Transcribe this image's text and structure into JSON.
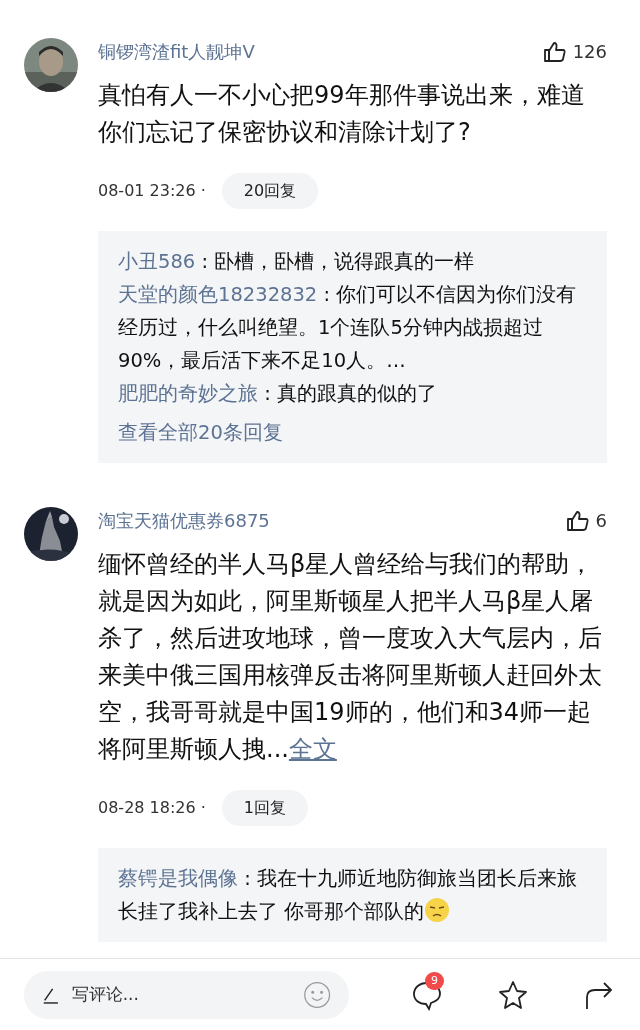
{
  "comments": [
    {
      "user": "铜锣湾渣fit人靓坤V",
      "likes": "126",
      "text": "真怕有人一不小心把99年那件事说出来，难道你们忘记了保密协议和清除计划了?",
      "time": "08-01 23:26 ·",
      "reply_count": "20回复",
      "replies": [
        {
          "user": "小丑586",
          "text": ": 卧槽，卧槽，说得跟真的一样"
        },
        {
          "user": "天堂的颜色18232832",
          "text": ": 你们可以不信因为你们没有经历过，什么叫绝望。1个连队5分钟内战损超过90%，最后活下来不足10人。…"
        },
        {
          "user": "肥肥的奇妙之旅",
          "text": ": 真的跟真的似的了"
        }
      ],
      "view_all": "查看全部20条回复"
    },
    {
      "user": "淘宝天猫优惠券6875",
      "likes": "6",
      "text": "缅怀曾经的半人马β星人曾经给与我们的帮助，就是因为如此，阿里斯顿星人把半人马β星人屠杀了，然后进攻地球，曾一度攻入大气层内，后来美中俄三国用核弹反击将阿里斯顿人赶回外太空，我哥哥就是中国19师的，他们和34师一起将阿里斯顿人拽...",
      "more": "全文",
      "time": "08-28 18:26 ·",
      "reply_count": "1回复",
      "replies": [
        {
          "user": "蔡锷是我偶像",
          "text": ": 我在十九师近地防御旅当团长后来旅长挂了我补上去了 你哥那个部队的",
          "emoji": true
        }
      ]
    }
  ],
  "bottom_bar": {
    "placeholder": "写评论...",
    "badge": "9"
  }
}
